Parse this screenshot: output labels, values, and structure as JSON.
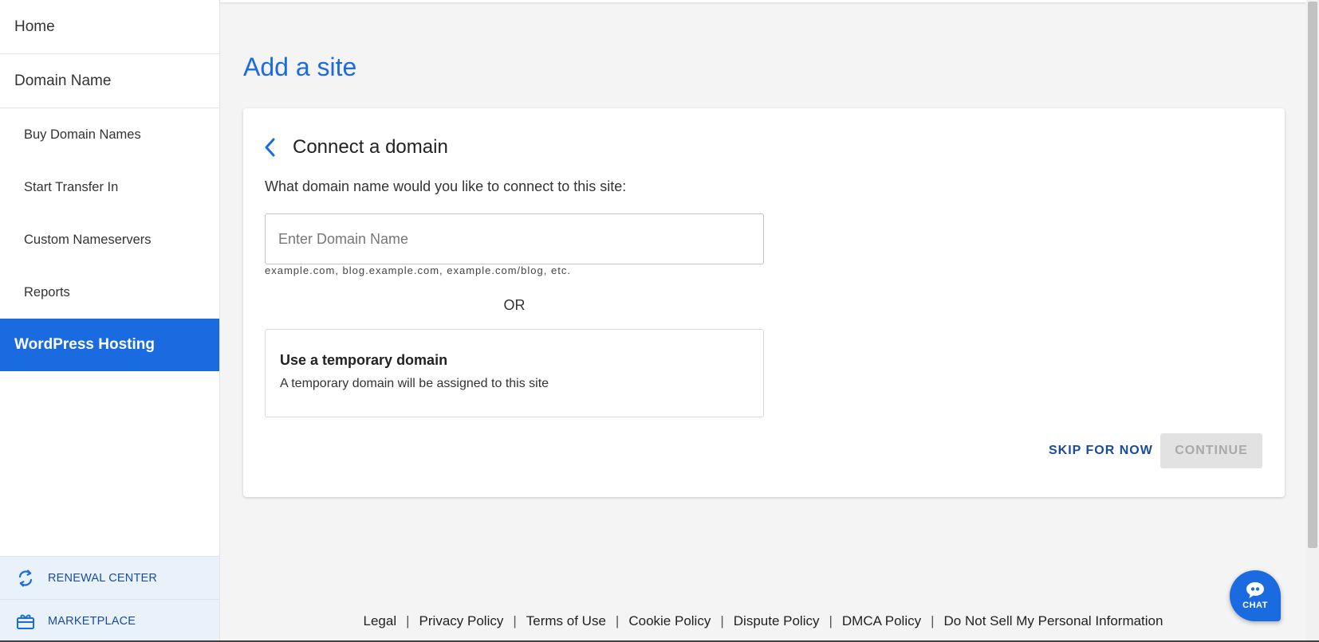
{
  "sidebar": {
    "home": "Home",
    "domain_name": "Domain Name",
    "sub_items": [
      "Buy Domain Names",
      "Start Transfer In",
      "Custom Nameservers",
      "Reports"
    ],
    "active_item": "WordPress Hosting",
    "bottom": {
      "renewal_center": "RENEWAL CENTER",
      "marketplace": "MARKETPLACE"
    }
  },
  "page": {
    "title": "Add a site"
  },
  "card": {
    "title": "Connect a domain",
    "question": "What domain name would you like to connect to this site:",
    "input_placeholder": "Enter Domain Name",
    "input_value": "",
    "hint": "example.com, blog.example.com, example.com/blog, etc.",
    "or_text": "OR",
    "temp_title": "Use a temporary domain",
    "temp_desc": "A temporary domain will be assigned to this site",
    "skip_label": "SKIP FOR NOW",
    "continue_label": "CONTINUE"
  },
  "footer": {
    "links": [
      "Legal",
      "Privacy Policy",
      "Terms of Use",
      "Cookie Policy",
      "Dispute Policy",
      "DMCA Policy",
      "Do Not Sell My Personal Information"
    ],
    "separator": "|"
  },
  "chat": {
    "label": "CHAT"
  },
  "icons": {
    "back": "chevron-left-icon",
    "renewal": "refresh-icon",
    "marketplace": "gift-icon",
    "chat": "chat-bubble-icon"
  },
  "colors": {
    "primary": "#1b6be0",
    "dark_blue": "#1a4c9a",
    "bottom_bg": "#e9f1fb",
    "disabled_bg": "#e2e2e2",
    "disabled_text": "#a9a9a9",
    "page_bg": "#f4f4f4"
  }
}
